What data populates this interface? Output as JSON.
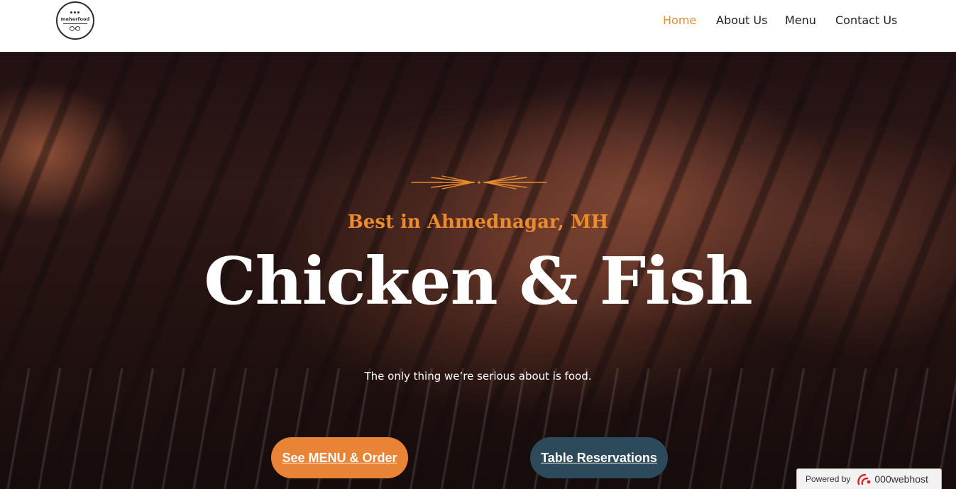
{
  "header": {
    "logo_text": "meherfood",
    "nav": [
      {
        "label": "Home",
        "active": true
      },
      {
        "label": "About Us",
        "active": false
      },
      {
        "label": "Menu",
        "active": false
      },
      {
        "label": "Contact Us",
        "active": false
      }
    ]
  },
  "hero": {
    "eyebrow": "Best in Ahmednagar, MH",
    "headline": "Chicken & Fish",
    "tagline": "The only thing we’re serious about is food.",
    "primary_button": "See MENU & Order",
    "secondary_button": "Table Reservations"
  },
  "badge": {
    "prefix": "Powered by",
    "brand": "000webhost"
  },
  "colors": {
    "accent": "#e98b2e",
    "primary_button": "#e98335",
    "secondary_button": "#2c4a59"
  }
}
